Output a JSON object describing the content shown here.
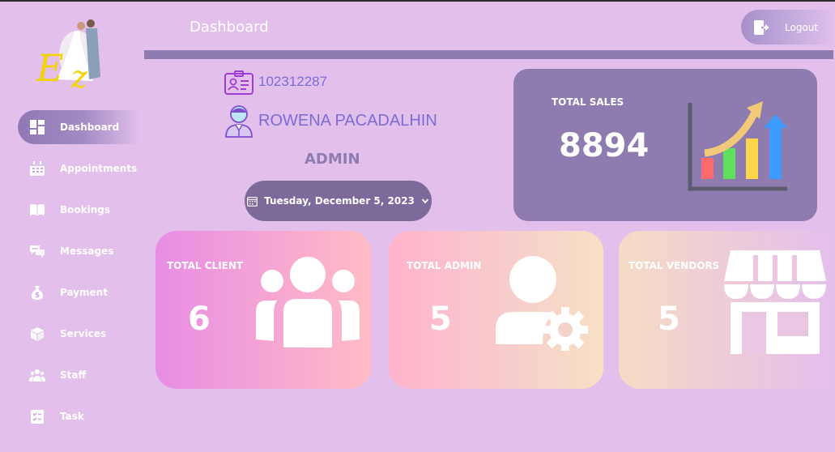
{
  "app": {
    "page_title": "Dashboard",
    "logout_label": "Logout",
    "logo_text": "Ez"
  },
  "sidebar": {
    "items": [
      {
        "label": "Dashboard",
        "icon": "dashboard-grid-icon",
        "active": true
      },
      {
        "label": "Appointments",
        "icon": "calendar-icon",
        "active": false
      },
      {
        "label": "Bookings",
        "icon": "open-book-icon",
        "active": false
      },
      {
        "label": "Messages",
        "icon": "chat-bubbles-icon",
        "active": false
      },
      {
        "label": "Payment",
        "icon": "money-bag-icon",
        "active": false
      },
      {
        "label": "Services",
        "icon": "box-icon",
        "active": false
      },
      {
        "label": "Staff",
        "icon": "users-icon",
        "active": false
      },
      {
        "label": "Task",
        "icon": "task-list-icon",
        "active": false
      }
    ]
  },
  "profile": {
    "user_id": "102312287",
    "name": "ROWENA PACADALHIN",
    "role": "ADMIN",
    "date": "Tuesday, December 5, 2023"
  },
  "stats": {
    "total_sales": {
      "label": "TOTAL SALES",
      "value": "8894"
    },
    "total_client": {
      "label": "TOTAL CLIENT",
      "value": "6"
    },
    "total_admin": {
      "label": "TOTAL ADMIN",
      "value": "5"
    },
    "total_vendors": {
      "label": "TOTAL VENDORS",
      "value": "5"
    }
  },
  "colors": {
    "background": "#e3bfec",
    "accent": "#8e7cb0",
    "date_pill": "#7c6a9a",
    "profile_text": "#7c6dd6"
  }
}
